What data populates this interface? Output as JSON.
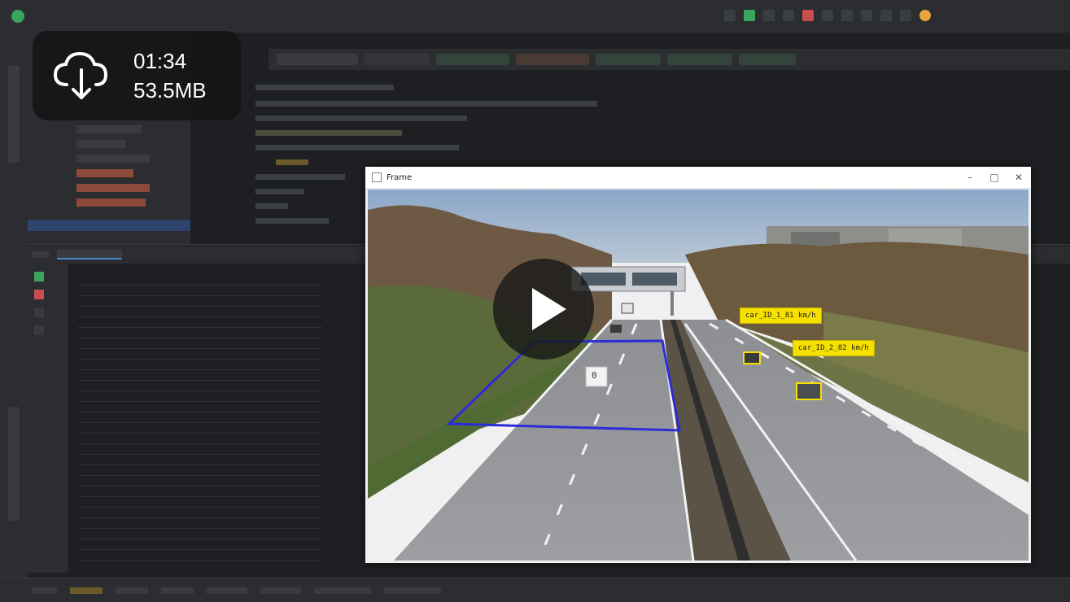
{
  "overlay": {
    "download_icon": "cloud-download-icon",
    "duration": "01:34",
    "size": "53.5MB",
    "play_icon": "play-icon"
  },
  "frame_window": {
    "title": "Frame",
    "minimize_icon": "minimize-icon",
    "maximize_icon": "maximize-icon",
    "close_icon": "close-icon",
    "detections": [
      {
        "label": "car_ID_1_81 km/h"
      },
      {
        "label": "car_ID_2_82 km/h"
      }
    ],
    "zone_marker": "0"
  },
  "colors": {
    "ide_bg": "#1e1f22",
    "panel_bg": "#2b2d30",
    "detection_box": "#f5e000",
    "zone_line": "#2c2cd6"
  }
}
